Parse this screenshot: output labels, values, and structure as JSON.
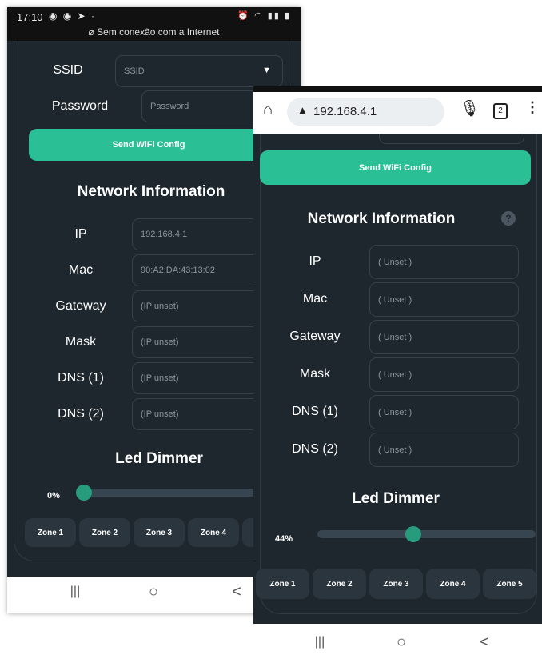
{
  "left": {
    "status_bar": {
      "time": "17:10",
      "notice": "Sem conexão com a Internet"
    },
    "ssid": {
      "label": "SSID",
      "placeholder": "SSID"
    },
    "password": {
      "label": "Password",
      "placeholder": "Password"
    },
    "send_button": "Send WiFi Config",
    "network_title": "Network Information",
    "fields": [
      {
        "label": "IP",
        "value": "192.168.4.1"
      },
      {
        "label": "Mac",
        "value": "90:A2:DA:43:13:02"
      },
      {
        "label": "Gateway",
        "value": "(IP unset)"
      },
      {
        "label": "Mask",
        "value": "(IP unset)"
      },
      {
        "label": "DNS (1)",
        "value": "(IP unset)"
      },
      {
        "label": "DNS (2)",
        "value": "(IP unset)"
      }
    ],
    "dimmer_title": "Led Dimmer",
    "dimmer_value": "0%",
    "dimmer_fraction": 0.0,
    "zones": [
      "Zone 1",
      "Zone 2",
      "Zone 3",
      "Zone 4"
    ],
    "nav": {
      "recent": "|||",
      "home": "○",
      "back": "<"
    }
  },
  "right": {
    "url": "192.168.4.1",
    "tab_count": "2",
    "send_button": "Send WiFi Config",
    "network_title": "Network Information",
    "help_glyph": "?",
    "fields": [
      {
        "label": "IP",
        "value": "( Unset )"
      },
      {
        "label": "Mac",
        "value": "( Unset )"
      },
      {
        "label": "Gateway",
        "value": "( Unset )"
      },
      {
        "label": "Mask",
        "value": "( Unset )"
      },
      {
        "label": "DNS (1)",
        "value": "( Unset )"
      },
      {
        "label": "DNS (2)",
        "value": "( Unset )"
      }
    ],
    "dimmer_title": "Led Dimmer",
    "dimmer_value": "44%",
    "dimmer_fraction": 0.44,
    "zones": [
      "Zone 1",
      "Zone 2",
      "Zone 3",
      "Zone 4",
      "Zone 5"
    ],
    "nav": {
      "recent": "|||",
      "home": "○",
      "back": "<"
    }
  }
}
